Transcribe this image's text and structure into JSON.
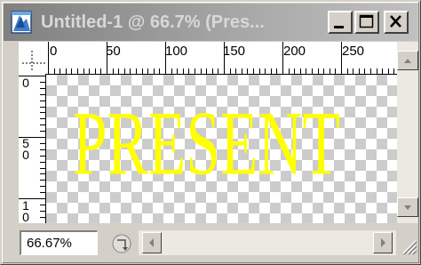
{
  "window": {
    "title": "Untitled-1 @ 66.7% (Pres...",
    "icon": "photoshop-document-icon",
    "buttons": {
      "minimize": "minimize-icon",
      "maximize": "maximize-icon",
      "close": "close-icon"
    }
  },
  "ruler": {
    "horizontal_labels": [
      "0",
      "50",
      "100",
      "150",
      "200",
      "250"
    ],
    "vertical_labels": [
      [
        "0"
      ],
      [
        "5",
        "0"
      ],
      [
        "1",
        "0"
      ]
    ]
  },
  "canvas": {
    "text": "PRESENT",
    "text_color": "#ffff00",
    "background": "transparency-checkerboard"
  },
  "status": {
    "zoom": "66.67%"
  },
  "colors": {
    "title_bar_inactive": "#808080",
    "chrome": "#d4d0c8"
  }
}
